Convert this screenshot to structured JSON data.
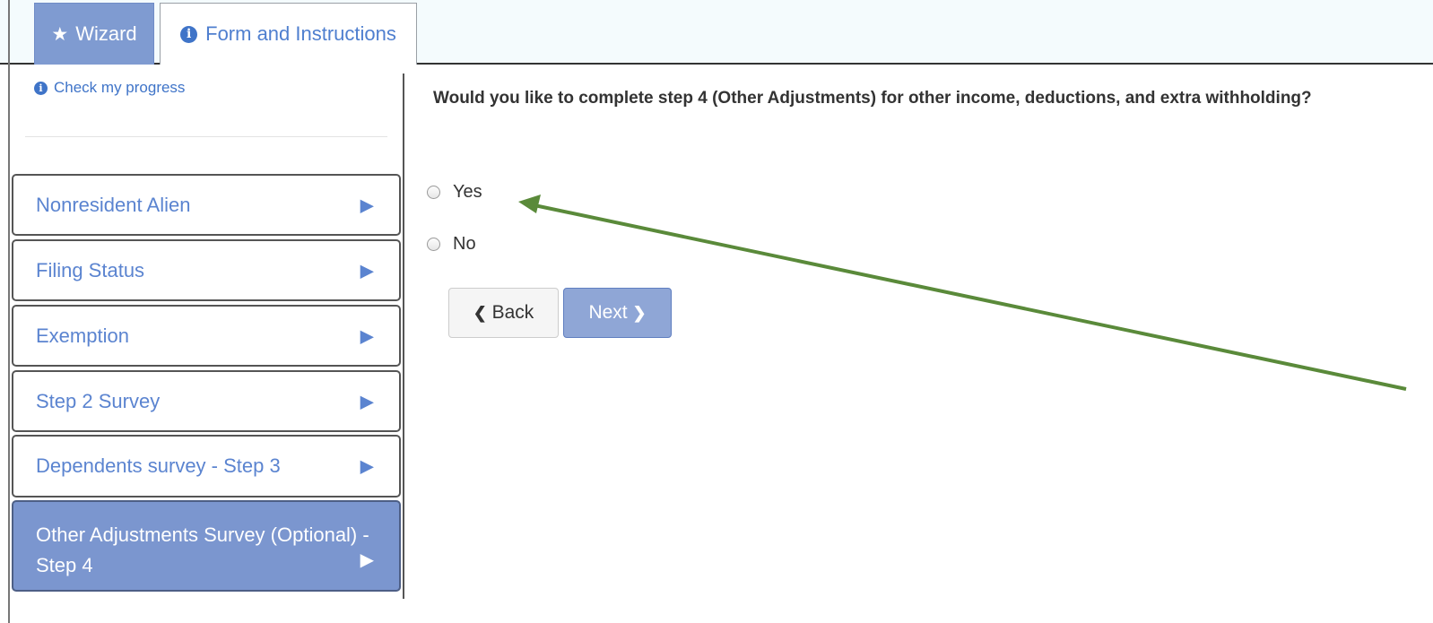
{
  "tabs": [
    {
      "label": "Wizard",
      "icon": "star-icon",
      "active": true
    },
    {
      "label": "Form and Instructions",
      "icon": "info-icon",
      "active": false
    }
  ],
  "sidebar": {
    "progress_link": "Check my progress",
    "steps": [
      {
        "label": "Nonresident Alien"
      },
      {
        "label": "Filing Status"
      },
      {
        "label": "Exemption"
      },
      {
        "label": "Step 2 Survey"
      },
      {
        "label": "Dependents survey - Step 3"
      },
      {
        "label": "Other Adjustments Survey (Optional) - Step 4",
        "active": true
      }
    ]
  },
  "main": {
    "question": "Would you like to complete step 4 (Other Adjustments) for other income, deductions, and extra withholding?",
    "options": [
      {
        "label": "Yes",
        "selected": false
      },
      {
        "label": "No",
        "selected": false
      }
    ],
    "back_label": "Back",
    "next_label": "Next"
  },
  "colors": {
    "accent": "#7b96cf",
    "link": "#5b84d0",
    "annotation_arrow": "#5a8a3a"
  }
}
